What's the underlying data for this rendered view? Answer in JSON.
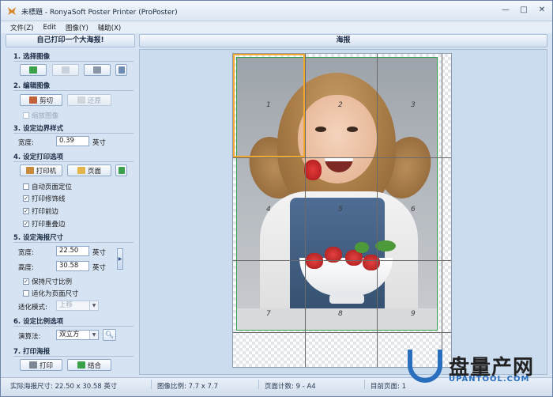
{
  "window": {
    "title": "未標題 - RonyaSoft Poster Printer (ProPoster)",
    "controls": [
      "—",
      "□",
      "✕"
    ]
  },
  "menu": [
    "文件(Z)",
    "Edit",
    "图像(Y)",
    "辅助(X)"
  ],
  "left_panel": {
    "header": "自己打印一个大海报!",
    "sections": {
      "s1": "1. 选择图像",
      "s2": "2. 编辑图像",
      "s3": "3. 设定边界样式",
      "s4": "4. 设定打印选项",
      "s5": "5. 设定海报尺寸",
      "s6": "6. 设定比例选项",
      "s7": "7. 打印海报"
    },
    "edit": {
      "crop": "剪切",
      "restore": "还原",
      "scale_image": "缩放图像"
    },
    "border": {
      "width_label": "宽度:",
      "width_value": "0.39",
      "unit": "英寸"
    },
    "print_opts": {
      "printer": "打印机",
      "page": "页面",
      "auto_position": "自动页面定位",
      "print_cut_lines": "打印修饰线",
      "print_margins": "打印前边",
      "print_overlap": "打印重叠边"
    },
    "poster_size": {
      "width_label": "宽度:",
      "width_value": "22.50",
      "height_label": "高度:",
      "height_value": "30.58",
      "unit": "英寸",
      "keep_ratio": "保持尺寸比例",
      "fit_page": "适化为页面尺寸",
      "mode_label": "适化模式:",
      "mode_value": "上移"
    },
    "scale": {
      "algo_label": "演算法:",
      "algo_value": "双立方"
    },
    "print": {
      "print": "打印",
      "finish": "结合"
    }
  },
  "right_panel": {
    "header": "海报",
    "tiles": [
      "1",
      "2",
      "3",
      "4",
      "5",
      "6",
      "7",
      "8",
      "9"
    ]
  },
  "status": {
    "actual_size": "实际海报尺寸: 22.50 x 30.58 英寸",
    "image_ratio": "图像比例: 7.7 x 7.7",
    "page_count": "页面计数: 9 - A4",
    "current_page": "目前页面: 1"
  },
  "watermark": {
    "brand": "盘量产网",
    "url": "UPANTOOL.COM"
  },
  "colors": {
    "accent_blue": "#2a6fbe",
    "selection": "#f0a830",
    "margin_green": "#2f9f4a"
  }
}
